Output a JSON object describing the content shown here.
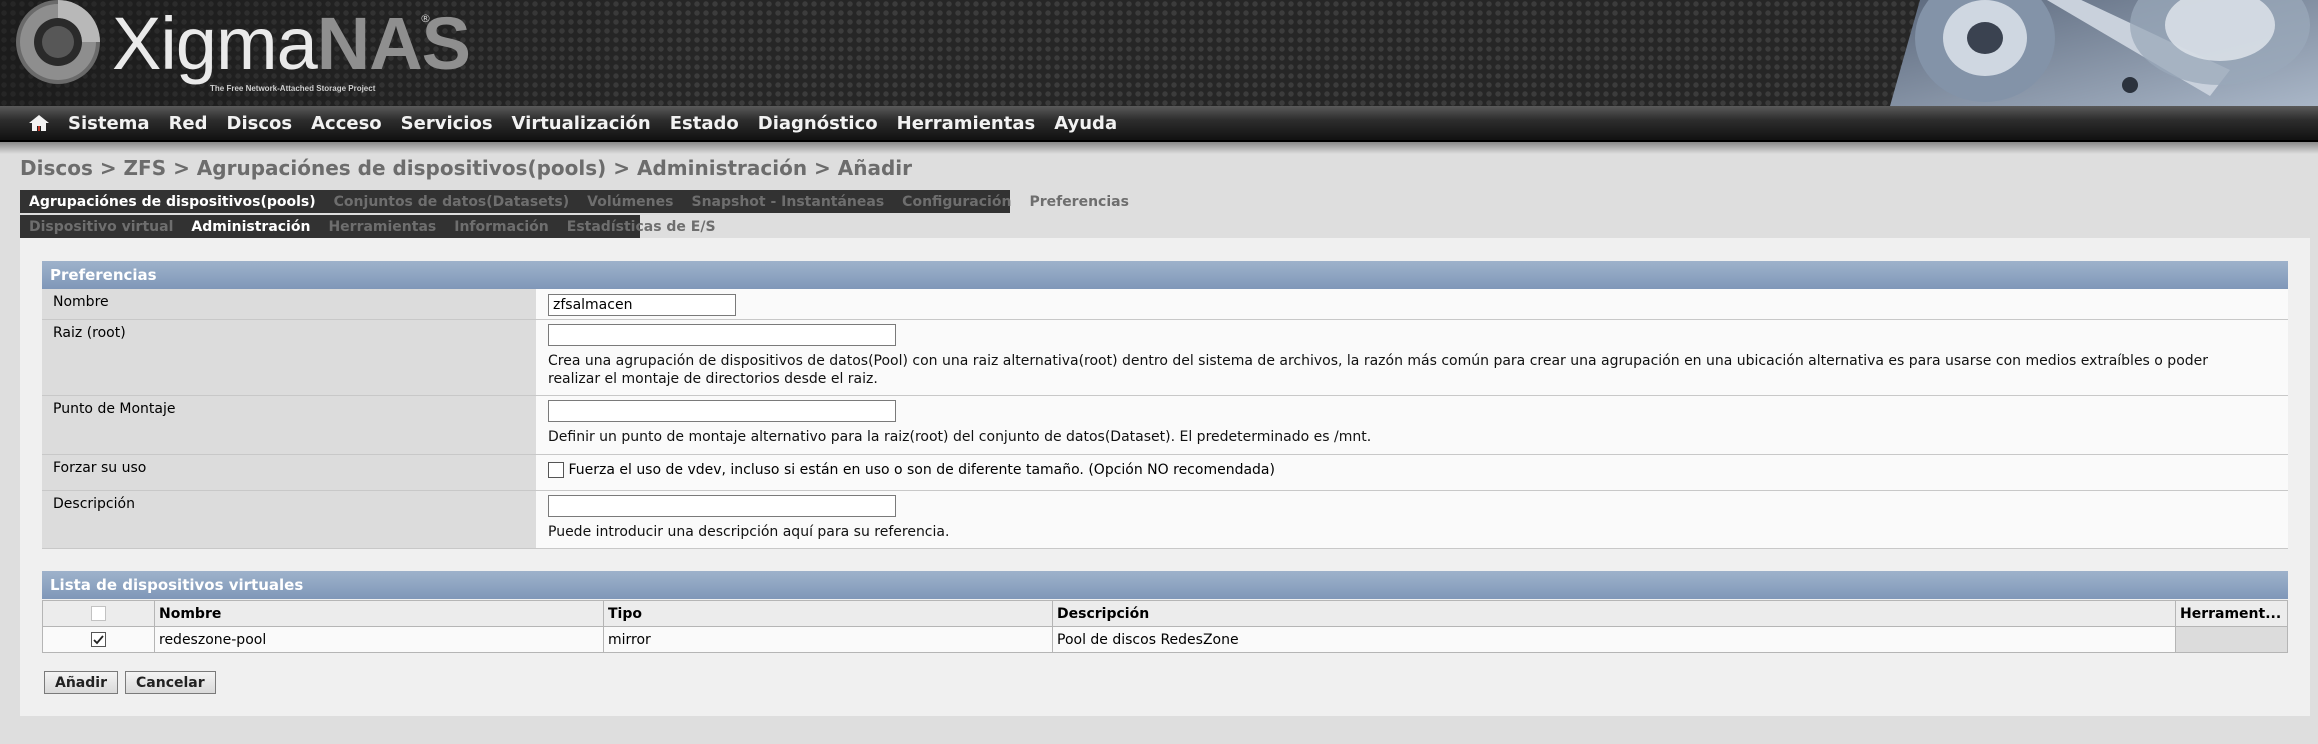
{
  "brand": {
    "name_part1": "Xigma",
    "name_part2": "NAS",
    "registered": "®",
    "tagline": "The Free Network-Attached Storage Project"
  },
  "nav": {
    "home_icon": "home-icon",
    "items": [
      "Sistema",
      "Red",
      "Discos",
      "Acceso",
      "Servicios",
      "Virtualización",
      "Estado",
      "Diagnóstico",
      "Herramientas",
      "Ayuda"
    ]
  },
  "breadcrumb": "Discos > ZFS > Agrupaciónes de dispositivos(pools) > Administración > Añadir",
  "tabs_primary": [
    "Agrupaciónes de dispositivos(pools)",
    "Conjuntos de datos(Datasets)",
    "Volúmenes",
    "Snapshot - Instantáneas",
    "Configuración",
    "Preferencias"
  ],
  "tabs_secondary": [
    "Dispositivo virtual",
    "Administración",
    "Herramientas",
    "Información",
    "Estadísticas de E/S"
  ],
  "preferences": {
    "title": "Preferencias",
    "nombre": {
      "label": "Nombre",
      "value": "zfsalmacen"
    },
    "raiz": {
      "label": "Raiz (root)",
      "value": "",
      "description": "Crea una agrupación de dispositivos de datos(Pool) con una raiz alternativa(root) dentro del sistema de archivos, la razón más común para crear una agrupación en una ubicación alternativa es para usarse con medios extraíbles o poder realizar el montaje de directorios desde el raiz."
    },
    "montaje": {
      "label": "Punto de Montaje",
      "value": "",
      "description": "Definir un punto de montaje alternativo para la raiz(root) del conjunto de datos(Dataset). El predeterminado es /mnt."
    },
    "forzar": {
      "label": "Forzar su uso",
      "checked": false,
      "text": "Fuerza el uso de vdev, incluso si están en uso o son de diferente tamaño. (Opción NO recomendada)"
    },
    "descripcion": {
      "label": "Descripción",
      "value": "",
      "description": "Puede introducir una descripción aquí para su referencia."
    }
  },
  "vdev_list": {
    "title": "Lista de dispositivos virtuales",
    "columns": [
      "Nombre",
      "Tipo",
      "Descripción",
      "Herrament..."
    ],
    "rows": [
      {
        "checked": true,
        "nombre": "redeszone-pool",
        "tipo": "mirror",
        "descripcion": "Pool de discos RedesZone"
      }
    ]
  },
  "buttons": {
    "add": "Añadir",
    "cancel": "Cancelar"
  }
}
